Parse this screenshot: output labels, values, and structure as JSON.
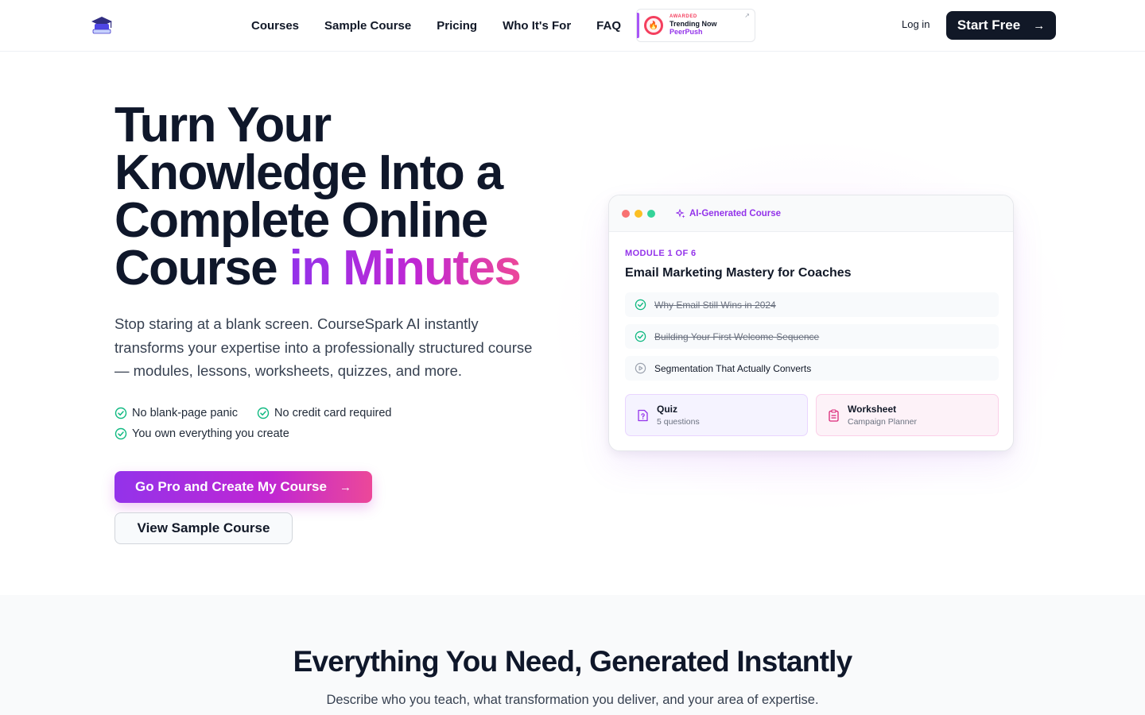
{
  "nav": {
    "links": [
      "Courses",
      "Sample Course",
      "Pricing",
      "Who It's For",
      "FAQ"
    ],
    "badge": {
      "awarded": "AWARDED",
      "title": "Trending Now",
      "brand": "PeerPush"
    },
    "login": "Log in",
    "start": "Start Free"
  },
  "hero": {
    "title_main": "Turn Your Knowledge Into a Complete Online Course",
    "title_accent": "in Minutes",
    "subtitle": "Stop staring at a blank screen. CourseSpark AI instantly transforms your expertise into a professionally structured course — modules, lessons, worksheets, quizzes, and more.",
    "checks": [
      "No blank-page panic",
      "No credit card required",
      "You own everything you create"
    ],
    "cta_primary": "Go Pro and Create My Course",
    "cta_secondary": "View Sample Course"
  },
  "card": {
    "tag": "AI-Generated Course",
    "module": "MODULE 1 OF 6",
    "title": "Email Marketing Mastery for Coaches",
    "lessons": [
      {
        "label": "Why Email Still Wins in 2024",
        "done": true
      },
      {
        "label": "Building Your First Welcome Sequence",
        "done": true
      },
      {
        "label": "Segmentation That Actually Converts",
        "done": false
      }
    ],
    "quiz": {
      "title": "Quiz",
      "sub": "5 questions"
    },
    "worksheet": {
      "title": "Worksheet",
      "sub": "Campaign Planner"
    }
  },
  "features": {
    "title": "Everything You Need, Generated Instantly",
    "subtitle": "Describe who you teach, what transformation you deliver, and your area of expertise."
  },
  "colors": {
    "accent": "#9333ea",
    "accent2": "#ec4899",
    "dark": "#111827",
    "success": "#10b981"
  }
}
